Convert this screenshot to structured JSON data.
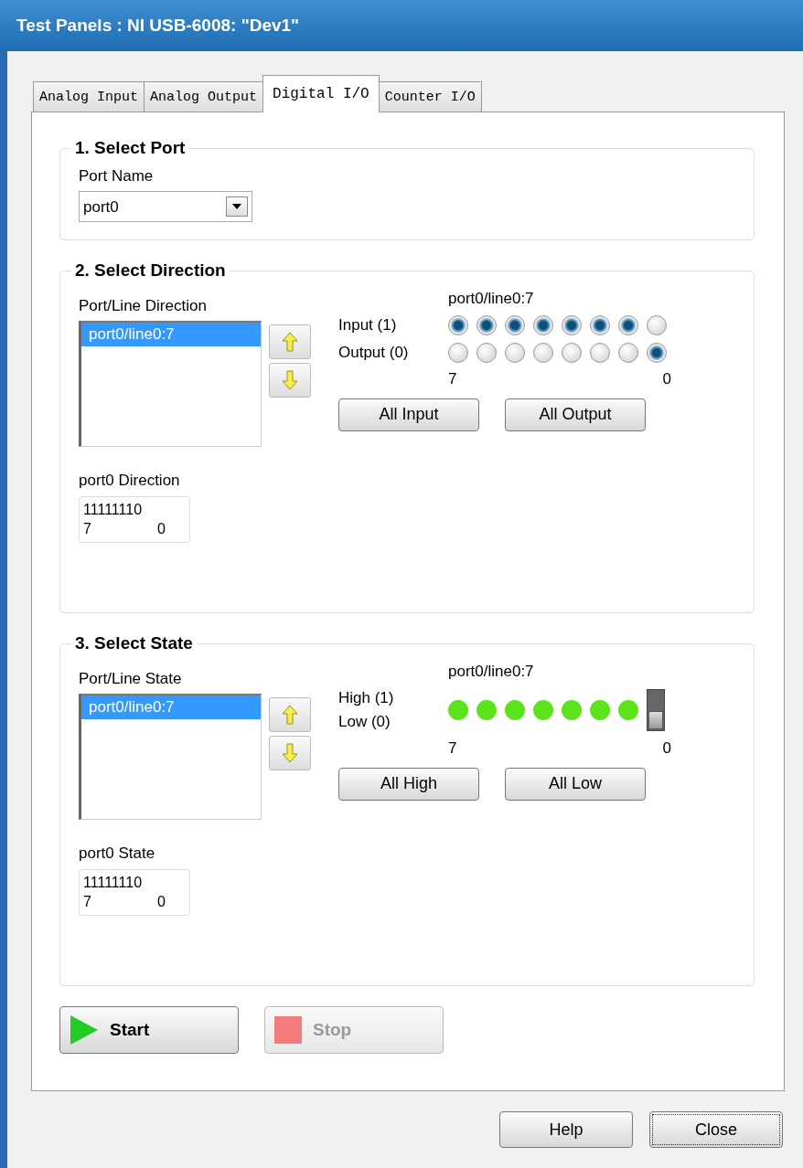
{
  "window": {
    "title": "Test Panels : NI USB-6008: \"Dev1\""
  },
  "tabs": [
    {
      "label": "Analog Input",
      "selected": false
    },
    {
      "label": "Analog Output",
      "selected": false
    },
    {
      "label": "Digital I/O",
      "selected": true
    },
    {
      "label": "Counter I/O",
      "selected": false
    }
  ],
  "port_group": {
    "title": "1. Select Port",
    "label": "Port Name",
    "value": "port0"
  },
  "direction_group": {
    "title": "2. Select Direction",
    "list_label": "Port/Line Direction",
    "list_items": [
      {
        "text": "port0/line0:7",
        "selected": true
      }
    ],
    "lines_label": "port0/line0:7",
    "row_labels": [
      "Input (1)",
      "Output (0)"
    ],
    "lines": [
      {
        "input": true
      },
      {
        "input": true
      },
      {
        "input": true
      },
      {
        "input": true
      },
      {
        "input": true
      },
      {
        "input": true
      },
      {
        "input": true
      },
      {
        "input": false
      }
    ],
    "axis_start": "7",
    "axis_end": "0",
    "buttons": [
      "All Input",
      "All Output"
    ],
    "summary_label": "port0 Direction",
    "summary_bits": "11111110",
    "summary_start": "7",
    "summary_end": "0"
  },
  "state_group": {
    "title": "3. Select State",
    "list_label": "Port/Line State",
    "list_items": [
      {
        "text": "port0/line0:7",
        "selected": true
      }
    ],
    "lines_label": "port0/line0:7",
    "row_labels": [
      "High (1)",
      "Low (0)"
    ],
    "lines": [
      {
        "kind": "led",
        "on": true
      },
      {
        "kind": "led",
        "on": true
      },
      {
        "kind": "led",
        "on": true
      },
      {
        "kind": "led",
        "on": true
      },
      {
        "kind": "led",
        "on": true
      },
      {
        "kind": "led",
        "on": true
      },
      {
        "kind": "led",
        "on": true
      },
      {
        "kind": "switch",
        "on": false
      }
    ],
    "axis_start": "7",
    "axis_end": "0",
    "buttons": [
      "All High",
      "All Low"
    ],
    "summary_label": "port0 State",
    "summary_bits": "11111110",
    "summary_start": "7",
    "summary_end": "0"
  },
  "run_buttons": [
    {
      "kind": "start",
      "label": "Start",
      "disabled": false
    },
    {
      "kind": "stop",
      "label": "Stop",
      "disabled": true
    }
  ],
  "dialog_buttons": [
    {
      "label": "Help",
      "focused": false
    },
    {
      "label": "Close",
      "focused": true
    }
  ]
}
